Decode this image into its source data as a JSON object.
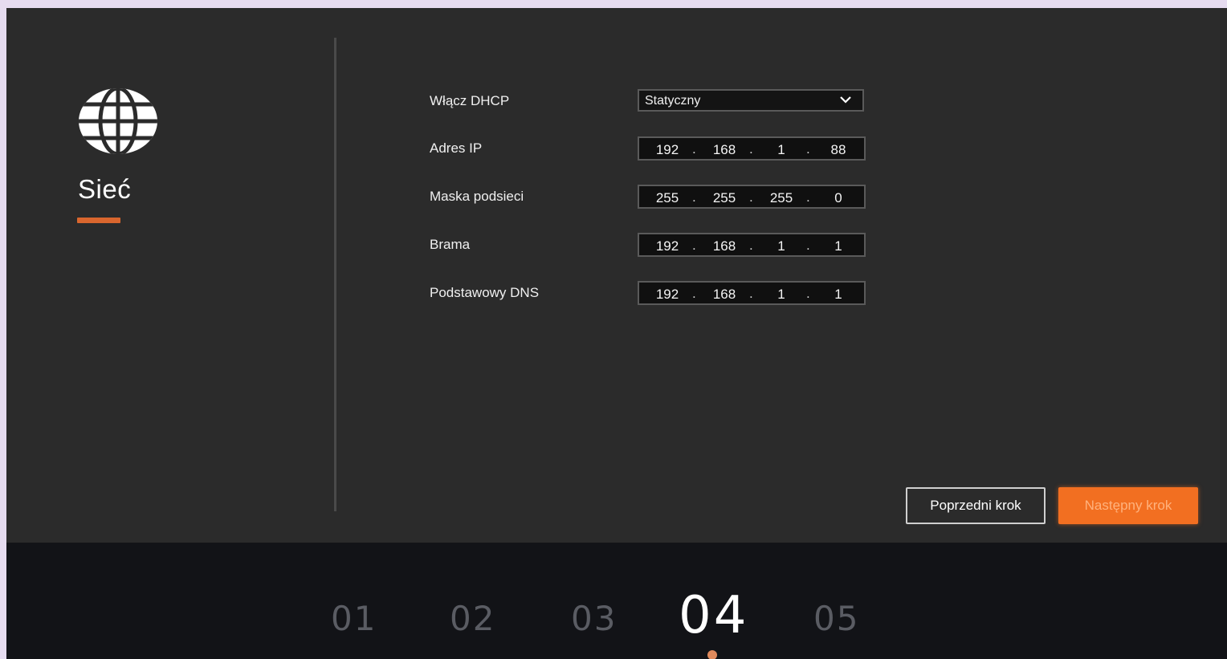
{
  "section": {
    "title": "Sieć",
    "icon": "globe-icon",
    "accent_color": "#d9662e"
  },
  "form": {
    "dhcp": {
      "label": "Włącz DHCP",
      "value": "Statyczny"
    },
    "ip_address": {
      "label": "Adres IP",
      "octets": [
        "192",
        "168",
        "1",
        "88"
      ]
    },
    "subnet_mask": {
      "label": "Maska podsieci",
      "octets": [
        "255",
        "255",
        "255",
        "0"
      ]
    },
    "gateway": {
      "label": "Brama",
      "octets": [
        "192",
        "168",
        "1",
        "1"
      ]
    },
    "primary_dns": {
      "label": "Podstawowy DNS",
      "octets": [
        "192",
        "168",
        "1",
        "1"
      ]
    },
    "separator": "."
  },
  "buttons": {
    "previous": "Poprzedni krok",
    "next": "Następny krok",
    "next_color": "#f26f21"
  },
  "steps": {
    "items": [
      "01",
      "02",
      "03",
      "04",
      "05"
    ],
    "active": "04"
  }
}
